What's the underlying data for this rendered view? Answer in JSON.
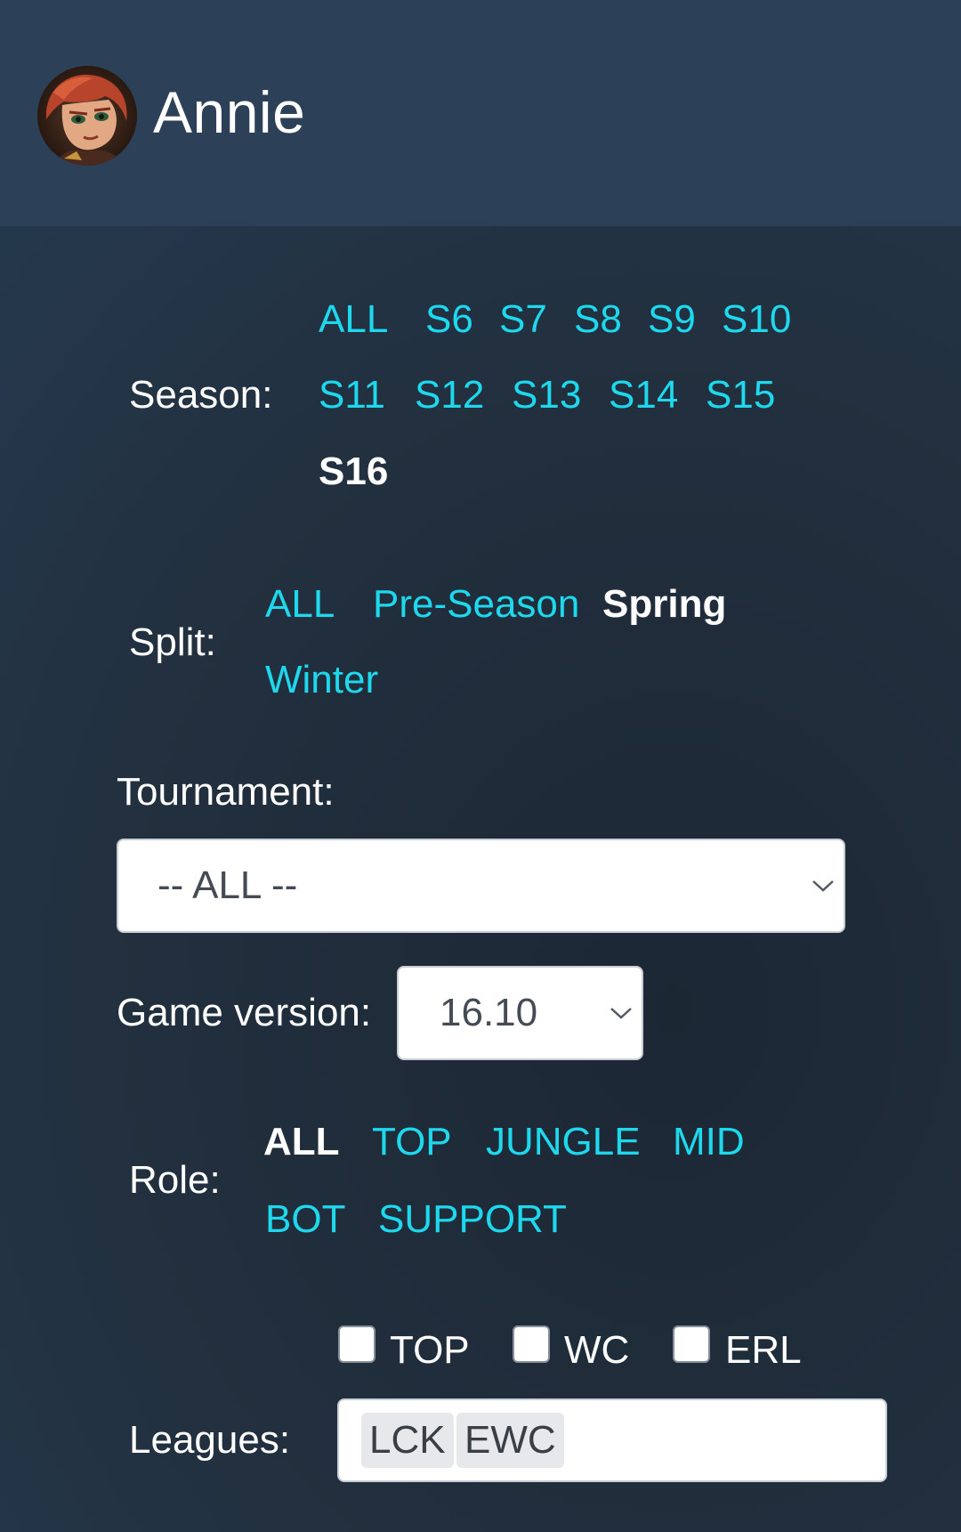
{
  "champion": {
    "name": "Annie",
    "avatar_icon": "annie-portrait"
  },
  "colors": {
    "header_bg": "#2c4157",
    "page_bg": "#1d2b3a",
    "link": "#1ed8ee",
    "active": "#ffffff"
  },
  "season": {
    "label": "Season:",
    "options": [
      "ALL",
      "S6",
      "S7",
      "S8",
      "S9",
      "S10",
      "S11",
      "S12",
      "S13",
      "S14",
      "S15",
      "S16"
    ],
    "selected": "S16"
  },
  "split": {
    "label": "Split:",
    "options": [
      "ALL",
      "Pre-Season",
      "Spring",
      "Winter"
    ],
    "selected": "Spring"
  },
  "tournament": {
    "label": "Tournament:",
    "selected": "-- ALL --",
    "icon": "chevron-down-icon"
  },
  "game_version": {
    "label": "Game version:",
    "selected": "16.10",
    "icon": "chevron-down-icon"
  },
  "role": {
    "label": "Role:",
    "options": [
      "ALL",
      "TOP",
      "JUNGLE",
      "MID",
      "BOT",
      "SUPPORT"
    ],
    "selected": "ALL"
  },
  "leagues": {
    "label": "Leagues:",
    "checkboxes": [
      {
        "label": "TOP",
        "checked": false
      },
      {
        "label": "WC",
        "checked": false
      },
      {
        "label": "ERL",
        "checked": false
      }
    ],
    "tags": [
      "LCK",
      "EWC"
    ]
  }
}
